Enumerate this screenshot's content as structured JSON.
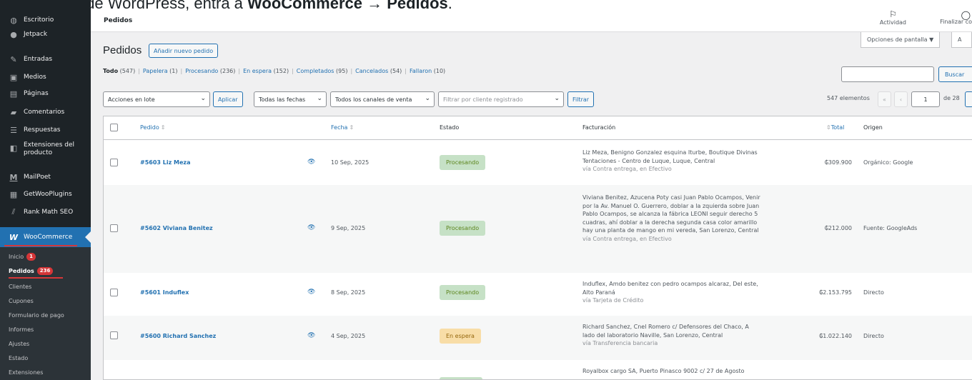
{
  "caption": {
    "prefix": "En el panel de WordPress, entra a ",
    "bold": "WooCommerce → Pedidos",
    "suffix": "."
  },
  "sidebar": {
    "items": [
      {
        "label": "Escritorio",
        "icon": "dashboard-icon"
      },
      {
        "label": "Jetpack",
        "icon": "jetpack-icon"
      },
      {
        "label": "Entradas",
        "icon": "pin-icon"
      },
      {
        "label": "Medios",
        "icon": "media-icon"
      },
      {
        "label": "Páginas",
        "icon": "pages-icon"
      },
      {
        "label": "Comentarios",
        "icon": "comments-icon"
      },
      {
        "label": "Respuestas",
        "icon": "responses-icon"
      },
      {
        "label": "Extensiones del producto",
        "icon": "product-extensions-icon"
      },
      {
        "label": "MailPoet",
        "icon": "mailpoet-icon"
      },
      {
        "label": "GetWooPlugins",
        "icon": "getwooplugins-icon"
      },
      {
        "label": "Rank Math SEO",
        "icon": "rankmath-icon"
      },
      {
        "label": "WooCommerce",
        "icon": "woocommerce-icon"
      }
    ],
    "submenu": [
      {
        "label": "Inicio",
        "badge": "1"
      },
      {
        "label": "Pedidos",
        "badge": "236"
      },
      {
        "label": "Clientes",
        "badge": ""
      },
      {
        "label": "Cupones",
        "badge": ""
      },
      {
        "label": "Formulario de pago",
        "badge": ""
      },
      {
        "label": "Informes",
        "badge": ""
      },
      {
        "label": "Ajustes",
        "badge": ""
      },
      {
        "label": "Estado",
        "badge": ""
      },
      {
        "label": "Extensiones",
        "badge": ""
      }
    ]
  },
  "topbar": {
    "title": "Pedidos",
    "activity": "Actividad",
    "finish": "Finalizar co",
    "screen_options": "Opciones de pantalla ▼",
    "help": "A"
  },
  "page": {
    "heading": "Pedidos",
    "add_new": "Añadir nuevo pedido",
    "views": [
      {
        "label": "Todo",
        "count": "(547)"
      },
      {
        "label": "Papelera",
        "count": "(1)"
      },
      {
        "label": "Procesando",
        "count": "(236)"
      },
      {
        "label": "En espera",
        "count": "(152)"
      },
      {
        "label": "Completados",
        "count": "(95)"
      },
      {
        "label": "Cancelados",
        "count": "(54)"
      },
      {
        "label": "Fallaron",
        "count": "(10)"
      }
    ],
    "search_button": "Buscar"
  },
  "filters": {
    "bulk_actions": "Acciones en lote",
    "apply": "Aplicar",
    "dates": "Todas las fechas",
    "channels": "Todos los canales de venta",
    "customer_placeholder": "Filtrar por cliente registrado",
    "filter": "Filtrar"
  },
  "pagination": {
    "items": "547 elementos",
    "first": "«",
    "prev": "‹",
    "current_page": "1",
    "of_pages": "de 28"
  },
  "table": {
    "headers": {
      "order": "Pedido",
      "date": "Fecha",
      "status": "Estado",
      "billing": "Facturación",
      "total": "Total",
      "origin": "Origen"
    },
    "rows": [
      {
        "order": "#5603 Liz Meza",
        "date": "10 Sep, 2025",
        "status": "Procesando",
        "billing": "Liz Meza, Benigno Gonzalez esquina Iturbe, Boutique Divinas Tentaciones - Centro de Luque, Luque, Central",
        "via": "vía Contra entrega, en Efectivo",
        "total": "₲309.900",
        "origin": "Orgánico: Google"
      },
      {
        "order": "#5602 Viviana Benitez",
        "date": "9 Sep, 2025",
        "status": "Procesando",
        "billing": "Viviana Benitez, Azucena Poty casi Juan Pablo Ocampos, Venir por la Av. Manuel O. Guerrero, doblar a la zquierda sobre Juan Pablo Ocampos, se alcanza la fábrica LEONI seguir derecho 5 cuadras, ahí doblar a la derecha segunda casa color amarillo hay una planta de mango en mi vereda, San Lorenzo, Central",
        "via": "vía Contra entrega, en Efectivo",
        "total": "₲212.000",
        "origin": "Fuente: GoogleAds"
      },
      {
        "order": "#5601 Induflex",
        "date": "8 Sep, 2025",
        "status": "Procesando",
        "billing": "Induflex, Amdo benitez con pedro ocampos alcaraz, Del este, Alto Paraná",
        "via": "vía Tarjeta de Crédito",
        "total": "₲2.153.795",
        "origin": "Directo"
      },
      {
        "order": "#5600 Richard Sanchez",
        "date": "4 Sep, 2025",
        "status": "En espera",
        "billing": "Richard Sanchez, Cnel Romero c/ Defensores del Chaco, A lado del laboratorio Naville, San Lorenzo, Central",
        "via": "vía Transferencia bancaria",
        "total": "₲1.022.140",
        "origin": "Directo"
      },
      {
        "order": "",
        "date": "",
        "status": "",
        "billing": "Royalbox cargo SA, Puerto Pinasco 9002 c/ 27 de Agosto",
        "via": "",
        "total": "",
        "origin": ""
      }
    ]
  },
  "colors": {
    "sidebar": "#1d2327",
    "accent": "#2271b1",
    "processing_bg": "#c6e1c6",
    "onhold_bg": "#f8dda7",
    "badge": "#d63638"
  }
}
